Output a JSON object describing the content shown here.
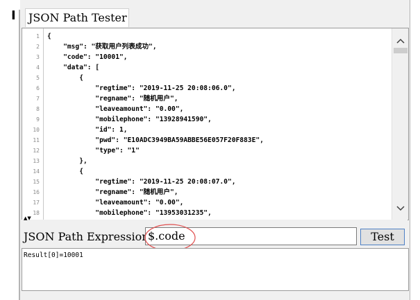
{
  "panel": {
    "title": "JSON Path Tester"
  },
  "editor": {
    "lines": [
      {
        "num": "1",
        "text": "{"
      },
      {
        "num": "2",
        "text": "    \"msg\": \"获取用户列表成功\","
      },
      {
        "num": "3",
        "text": "    \"code\": \"10001\","
      },
      {
        "num": "4",
        "text": "    \"data\": ["
      },
      {
        "num": "5",
        "text": "        {"
      },
      {
        "num": "6",
        "text": "            \"regtime\": \"2019-11-25 20:08:06.0\","
      },
      {
        "num": "7",
        "text": "            \"regname\": \"随机用户\","
      },
      {
        "num": "8",
        "text": "            \"leaveamount\": \"0.00\","
      },
      {
        "num": "9",
        "text": "            \"mobilephone\": \"13928941590\","
      },
      {
        "num": "10",
        "text": "            \"id\": 1,"
      },
      {
        "num": "11",
        "text": "            \"pwd\": \"E10ADC3949BA59ABBE56E057F20F883E\","
      },
      {
        "num": "12",
        "text": "            \"type\": \"1\""
      },
      {
        "num": "13",
        "text": "        },"
      },
      {
        "num": "14",
        "text": "        {"
      },
      {
        "num": "15",
        "text": "            \"regtime\": \"2019-11-25 20:08:07.0\","
      },
      {
        "num": "16",
        "text": "            \"regname\": \"随机用户\","
      },
      {
        "num": "17",
        "text": "            \"leaveamount\": \"0.00\","
      },
      {
        "num": "18",
        "text": "            \"mobilephone\": \"13953031235\","
      }
    ],
    "scroll_up_glyph": "^",
    "scroll_down_glyph": "v"
  },
  "expression": {
    "label": "JSON Path Expression",
    "value": "$.code",
    "button_label": "Test",
    "annotation_color": "#e05050"
  },
  "result": {
    "text": "Result[0]=10001"
  }
}
